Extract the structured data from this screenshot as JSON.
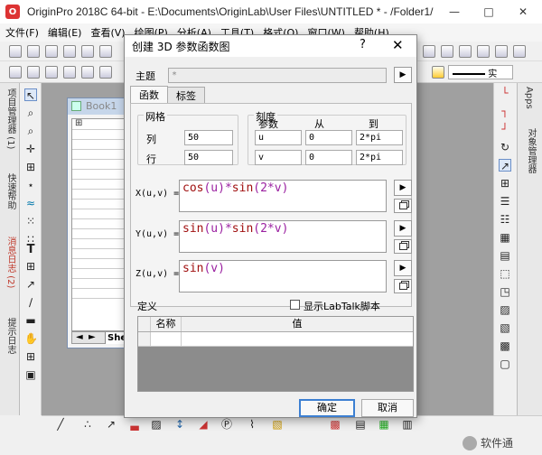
{
  "window": {
    "title": "OriginPro 2018C 64-bit - E:\\Documents\\OriginLab\\User Files\\UNTITLED * - /Folder1/"
  },
  "menu": [
    "文件(F)",
    "编辑(E)",
    "查看(V)",
    "绘图(P)",
    "分析(A)",
    "工具(T)",
    "格式(O)",
    "窗口(W)",
    "帮助(H)"
  ],
  "left_dock_tabs": [
    "项目管理器 (1)",
    "快速帮助",
    "消息日志 (2)",
    "提示日志"
  ],
  "right_dock_tabs": [
    "Apps",
    "对象管理器"
  ],
  "book": {
    "title": "Book1",
    "row_labels": [
      "长名",
      "单",
      "注",
      "F("
    ],
    "sheet": "Shee"
  },
  "toolbar2": {
    "line_style": "实"
  },
  "dialog": {
    "title": "创建 3D 参数函数图",
    "help": "?",
    "theme_label": "主题",
    "theme_value": "*",
    "tabs": [
      "函数",
      "标签"
    ],
    "grid": {
      "label": "网格",
      "col_label": "列",
      "col_value": "50",
      "row_label": "行",
      "row_value": "50"
    },
    "scale": {
      "label": "刻度",
      "param_header": "参数",
      "from_header": "从",
      "to_header": "到",
      "rows": [
        {
          "param": "u",
          "from": "0",
          "to": "2*pi"
        },
        {
          "param": "v",
          "from": "0",
          "to": "2*pi"
        }
      ]
    },
    "x_label": "X(u,v) =",
    "x_func": "sin",
    "x_expr": {
      "f1": "cos",
      "a1": "(u)",
      "op": "*",
      "f2": "sin",
      "a2": "(2*v)"
    },
    "y_label": "Y(u,v) =",
    "y_expr": {
      "f1": "sin",
      "a1": "(u)",
      "op": "*",
      "f2": "sin",
      "a2": "(2*v)"
    },
    "z_label": "Z(u,v) =",
    "z_expr": {
      "f1": "sin",
      "a1": "(v)"
    },
    "definition_label": "定义",
    "show_labtalk": "显示LabTalk脚本",
    "table_headers": [
      "名称",
      "值"
    ],
    "ok": "确定",
    "cancel": "取消"
  },
  "watermark": "软件通"
}
